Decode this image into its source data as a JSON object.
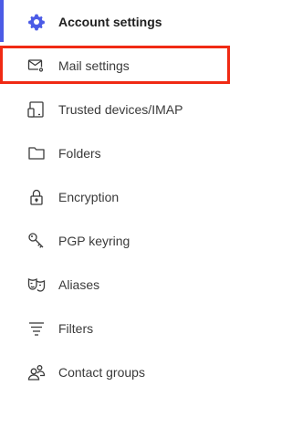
{
  "sidebar": {
    "accent_color": "#4b5be6",
    "highlight_color": "#f02a14",
    "items": [
      {
        "label": "Account settings",
        "icon": "gear-icon",
        "active": true
      },
      {
        "label": "Mail settings",
        "icon": "mail-settings-icon",
        "highlighted": true
      },
      {
        "label": "Trusted devices/IMAP",
        "icon": "devices-icon"
      },
      {
        "label": "Folders",
        "icon": "folder-icon"
      },
      {
        "label": "Encryption",
        "icon": "lock-icon"
      },
      {
        "label": "PGP keyring",
        "icon": "key-icon"
      },
      {
        "label": "Aliases",
        "icon": "masks-icon"
      },
      {
        "label": "Filters",
        "icon": "filter-icon"
      },
      {
        "label": "Contact groups",
        "icon": "contact-group-icon"
      }
    ]
  }
}
